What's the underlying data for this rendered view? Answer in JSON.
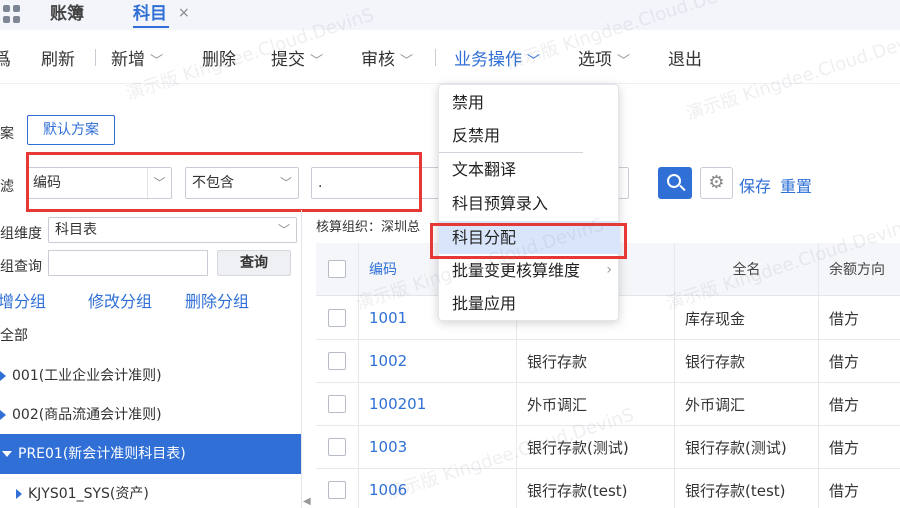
{
  "tabs": {
    "ledger": "账簿",
    "subject": "科目",
    "close": "×"
  },
  "toolbar": {
    "prev_cut": "爲",
    "refresh": "刷新",
    "add": "新增",
    "delete": "删除",
    "submit": "提交",
    "audit": "审核",
    "business_ops": "业务操作",
    "options": "选项",
    "exit": "退出"
  },
  "filter": {
    "plan_label": "案",
    "default_plan": "默认方案",
    "filter_label": "滤",
    "field": "编码",
    "operator": "不包含",
    "value": ".",
    "save": "保存",
    "reset": "重置"
  },
  "left": {
    "group_dim_label": "组维度",
    "group_dim_value": "科目表",
    "group_query_label": "组查询",
    "query_btn": "查询",
    "add_group": "增分组",
    "edit_group": "修改分组",
    "delete_group": "删除分组",
    "tree": [
      "全部",
      "001(工业企业会计准则)",
      "002(商品流通会计准则)",
      "PRE01(新会计准则科目表)",
      "KJYS01_SYS(资产)"
    ]
  },
  "table": {
    "org_label": "核算组织：深圳总",
    "headers": {
      "code": "编码",
      "name": "",
      "fullname": "全名",
      "direction": "余额方向"
    },
    "rows": [
      {
        "code": "1001",
        "name": "",
        "fullname": "库存现金",
        "direction": "借方"
      },
      {
        "code": "1002",
        "name": "银行存款",
        "fullname": "银行存款",
        "direction": "借方"
      },
      {
        "code": "100201",
        "name": "外币调汇",
        "fullname": "外币调汇",
        "direction": "借方"
      },
      {
        "code": "1003",
        "name": "银行存款(测试)",
        "fullname": "银行存款(测试)",
        "direction": "借方"
      },
      {
        "code": "1006",
        "name": "银行存款(test)",
        "fullname": "银行存款(test)",
        "direction": "借方"
      }
    ]
  },
  "menu": {
    "items": [
      "禁用",
      "反禁用",
      "文本翻译",
      "科目预算录入",
      "科目分配",
      "批量变更核算维度",
      "批量应用"
    ],
    "highlighted_index": 4
  },
  "watermark": "演示版 Kingdee.Cloud.DevinS",
  "colors": {
    "accent": "#2f6fd6",
    "highlight_box": "#e53935",
    "selected_tree": "#2f6fd6"
  }
}
